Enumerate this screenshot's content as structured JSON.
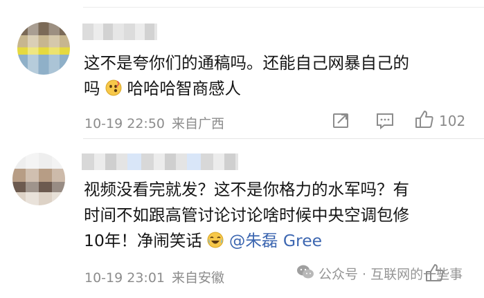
{
  "comments": [
    {
      "text_line1": "这不是夸你们的通稿吗。还能自己网暴自己的",
      "text_line2_pre": "吗",
      "text_line2_post": "哈哈哈智商感人",
      "time": "10-19 22:50",
      "location": "来自广西",
      "likes": "102"
    },
    {
      "text_line1": "视频没看完就发？这不是你格力的水军吗？有",
      "text_line2": "时间不如跟高管讨论讨论啥时候中央空调包修",
      "text_line3_pre": "10年！净闹笑话",
      "mention": "@朱磊 Gree",
      "time": "10-19 23:01",
      "location": "来自安徽"
    }
  ],
  "watermark": {
    "text": "公众号 · 互联网的一些事",
    "icon": "wechat-icon"
  },
  "icons": {
    "share": "share-icon",
    "reply": "reply-icon",
    "like": "thumbs-up-icon"
  },
  "colors": {
    "mention": "#3d67b1",
    "meta": "#8c8c8c"
  }
}
